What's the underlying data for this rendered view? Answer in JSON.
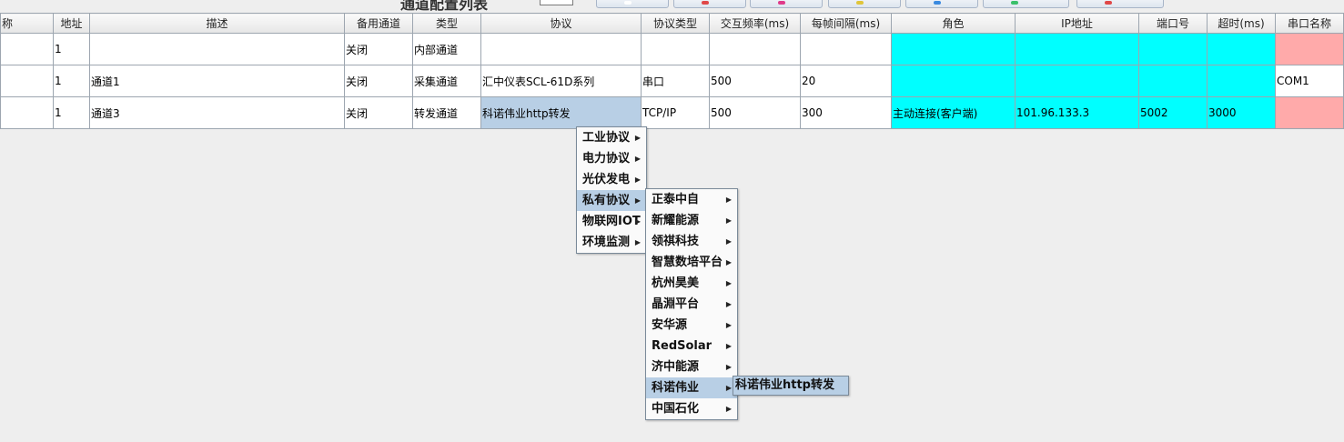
{
  "toolbar": {
    "title": "通道配置列表",
    "buttons": [
      {
        "name": "toolbar-button-1",
        "color": "#ffffff"
      },
      {
        "name": "toolbar-button-2",
        "color": "#e04848"
      },
      {
        "name": "toolbar-button-3",
        "color": "#e03a8a"
      },
      {
        "name": "toolbar-button-4",
        "color": "#e0c53a"
      },
      {
        "name": "toolbar-button-5",
        "color": "#3a8ae0"
      },
      {
        "name": "toolbar-button-6",
        "color": "#3ac06a"
      },
      {
        "name": "toolbar-button-7",
        "color": "#e04848"
      }
    ]
  },
  "table": {
    "columns": [
      "称",
      "地址",
      "描述",
      "备用通道",
      "类型",
      "协议",
      "协议类型",
      "交互频率(ms)",
      "每帧间隔(ms)",
      "角色",
      "IP地址",
      "端口号",
      "超时(ms)",
      "串口名称"
    ],
    "rows": [
      [
        "",
        "1",
        "",
        "关闭",
        "内部通道",
        "",
        "",
        "",
        "",
        "",
        "",
        "",
        "",
        ""
      ],
      [
        "",
        "1",
        "通道1",
        "关闭",
        "采集通道",
        "汇中仪表SCL-61D系列",
        "串口",
        "500",
        "20",
        "",
        "",
        "",
        "",
        "COM1"
      ],
      [
        "",
        "1",
        "通道3",
        "关闭",
        "转发通道",
        "科诺伟业http转发",
        "TCP/IP",
        "500",
        "300",
        "主动连接(客户端)",
        "101.96.133.3",
        "5002",
        "3000",
        ""
      ]
    ],
    "colors": {
      "cyan": "#00ffff",
      "pink": "#ffaaaa",
      "selected": "#b8cfe5"
    }
  },
  "menus": {
    "level1": [
      "工业协议",
      "电力协议",
      "光伏发电",
      "私有协议",
      "物联网IOT",
      "环境监测"
    ],
    "level1_highlight": 3,
    "level2": [
      "正泰中自",
      "新耀能源",
      "领祺科技",
      "智慧数培平台",
      "杭州昊美",
      "晶淵平台",
      "安华源",
      "RedSolar",
      "济中能源",
      "科诺伟业",
      "中国石化"
    ],
    "level2_highlight": 9,
    "level3": [
      "科诺伟业http转发"
    ],
    "arrow": "▶"
  }
}
